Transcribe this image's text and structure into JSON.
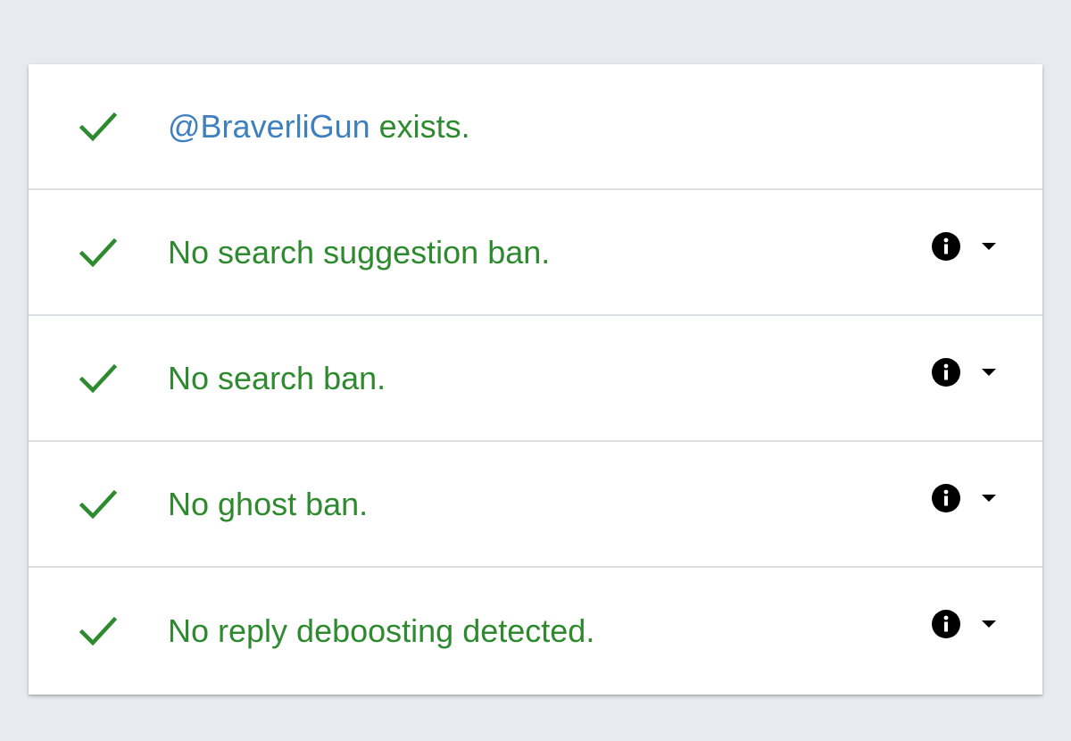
{
  "checks": {
    "account": {
      "status": "pass",
      "handle": "@BraverliGun",
      "suffix": " exists."
    },
    "items": [
      {
        "status": "pass",
        "label": "No search suggestion ban."
      },
      {
        "status": "pass",
        "label": "No search ban."
      },
      {
        "status": "pass",
        "label": "No ghost ban."
      },
      {
        "status": "pass",
        "label": "No reply deboosting detected."
      }
    ]
  },
  "icons": {
    "status": "check-icon",
    "info": "info-icon",
    "expand": "caret-down-icon"
  },
  "colors": {
    "background": "#e7ebef",
    "card": "#ffffff",
    "success_green": "#2e8a2e",
    "handle_blue": "#3d7fbf",
    "divider": "#dcdfe3",
    "icon_black": "#000000"
  }
}
